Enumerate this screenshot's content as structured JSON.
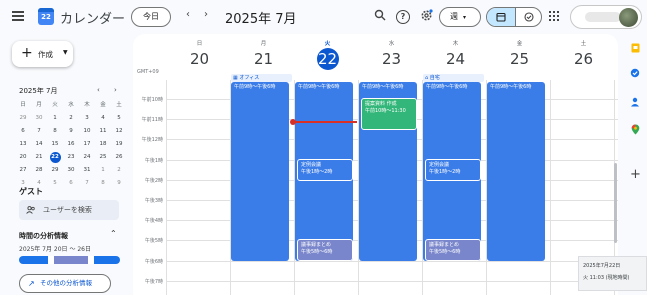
{
  "header": {
    "app_title": "カレンダー",
    "logo_number": "22",
    "today_button": "今日",
    "prev_arrow": "‹",
    "next_arrow": "›",
    "current_period": "2025年 7月",
    "view_select": "週",
    "icons": [
      "menu-icon",
      "search-icon",
      "help-icon",
      "settings-icon",
      "calendar-icon",
      "tasks-icon",
      "apps-icon"
    ]
  },
  "sidebar": {
    "create_button": "作成",
    "mini_calendar": {
      "title": "2025年 7月",
      "weekdays": [
        "日",
        "月",
        "火",
        "水",
        "木",
        "金",
        "土"
      ],
      "weeks": [
        [
          "29",
          "30",
          "1",
          "2",
          "3",
          "4",
          "5"
        ],
        [
          "6",
          "7",
          "8",
          "9",
          "10",
          "11",
          "12"
        ],
        [
          "13",
          "14",
          "15",
          "16",
          "17",
          "18",
          "19"
        ],
        [
          "20",
          "21",
          "22",
          "23",
          "24",
          "25",
          "26"
        ],
        [
          "27",
          "28",
          "29",
          "30",
          "31",
          "1",
          "2"
        ],
        [
          "3",
          "4",
          "5",
          "6",
          "7",
          "8",
          "9"
        ]
      ],
      "today": "22"
    },
    "guest_title": "ゲスト",
    "guest_search": "ユーザーを検索",
    "analysis_title": "時間の分析情報",
    "analysis_range": "2025年 7月 20日 〜 26日",
    "analysis_segments": [
      {
        "value": 0.29,
        "color": "#1a73e8"
      },
      {
        "value": 0.06,
        "color": "#ffffff"
      },
      {
        "value": 0.33,
        "color": "#7986cb"
      },
      {
        "value": 0.06,
        "color": "#ffffff"
      },
      {
        "value": 0.26,
        "color": "#1a73e8"
      }
    ],
    "more_insights": "その他の分析情報"
  },
  "calendar": {
    "timezone": "GMT+09",
    "days": [
      {
        "name": "日",
        "number": "20"
      },
      {
        "name": "月",
        "number": "21"
      },
      {
        "name": "火",
        "number": "22",
        "today": true
      },
      {
        "name": "水",
        "number": "23"
      },
      {
        "name": "木",
        "number": "24"
      },
      {
        "name": "金",
        "number": "25"
      },
      {
        "name": "土",
        "number": "26"
      }
    ],
    "allday": {
      "office": "オフィス",
      "home": "自宅"
    },
    "hours": [
      "午前10時",
      "午前11時",
      "午後12時",
      "午後1時",
      "午後2時",
      "午後3時",
      "午後4時",
      "午後5時",
      "午後6時",
      "午後7時"
    ],
    "events": {
      "mon_main": "午前9時〜午後6時",
      "tue_main": "午前9時〜午後6時",
      "wed_main": "午前9時〜午後6時",
      "thu_main": "午前9時〜午後6時",
      "fri_main": "午前9時〜午後6時",
      "wed_inner_title": "提案資料 作成",
      "wed_inner_time": "午前10時〜11:30",
      "tue_meeting_title": "定例会議",
      "tue_meeting_time": "午後1時〜2時",
      "thu_meeting_title": "定例会議",
      "thu_meeting_time": "午後1時〜2時",
      "tue_minutes_title": "議事録まとめ",
      "tue_minutes_time": "午後5時〜6時",
      "thu_minutes_title": "議事録まとめ",
      "thu_minutes_time": "午後5時〜6時"
    },
    "colors": {
      "event_blue": "#3b7de8",
      "event_green": "#33b679",
      "event_lavender": "#7986cb",
      "today_blue": "#0b57d0",
      "now_red": "#d93025"
    }
  },
  "tooltip": {
    "date": "2025年7月22日",
    "time": "火 11:03 (現地時間)"
  }
}
